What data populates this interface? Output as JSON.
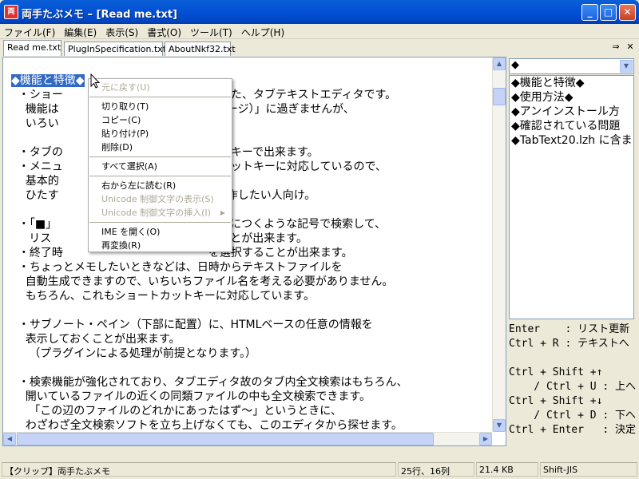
{
  "window": {
    "title": "両手たぶメモ – [Read me.txt]",
    "icon_glyph": "両",
    "buttons": {
      "minimize": "_",
      "maximize": "□",
      "close": "✕"
    }
  },
  "menu": [
    "ファイル(F)",
    "編集(E)",
    "表示(S)",
    "書式(O)",
    "ツール(T)",
    "ヘルプ(H)"
  ],
  "tabs": [
    {
      "label": "Read me.txt",
      "active": true
    },
    {
      "label": "PlugInSpecification.txt",
      "active": false
    },
    {
      "label": "AboutNkf32.txt",
      "active": false
    }
  ],
  "tab_controls": {
    "arrow": "⇒",
    "close": "✕"
  },
  "editor": {
    "lines": [
      {
        "selected": "◆機能と特徴◆",
        "text": ""
      },
      {
        "text": "  ・ショー　　　　　　　　　　　　　現した、タブテキストエディタです。"
      },
      {
        "text": "    機能は　　　　　　　　　　　　　２ページ）」に過ぎませんが、"
      },
      {
        "text": "    いろい　　　　　　　　　　　　　ます。"
      },
      {
        "text": ""
      },
      {
        "text": "  ・タブの　　　　　　　　　　　　　ットキーで出来ます。"
      },
      {
        "text": "  ・メニュ　　　　　　　　　　　　　トカットキーに対応しているので、"
      },
      {
        "text": "    基本的　　　　　　　　　　　　　ん。"
      },
      {
        "text": "    ひたす　　　　　　　　　　　　　を操作したい人向け。"
      },
      {
        "text": ""
      },
      {
        "text": "  ・「■」　　　　　　　　　　　　　トの頭につくような記号で検索して、"
      },
      {
        "text": "     リス　　　　　　　　　　　　　おくことが出来ます。"
      },
      {
        "text": "  ・終了時　　　　　　　　　　　　　を選択することが出来ます。"
      },
      {
        "text": "  ・ちょっとメモしたいときなどは、日時からテキストファイルを"
      },
      {
        "text": "    自動生成できますので、いちいちファイル名を考える必要がありません。"
      },
      {
        "text": "    もちろん、これもショートカットキーに対応しています。"
      },
      {
        "text": ""
      },
      {
        "text": "  ・サブノート・ペイン（下部に配置）に、HTMLベースの任意の情報を"
      },
      {
        "text": "    表示しておくことが出来ます。"
      },
      {
        "text": "     （プラグインによる処理が前提となります。）"
      },
      {
        "text": ""
      },
      {
        "text": "  ・検索機能が強化されており、タブエディタ故のタブ内全文検索はもちろん、"
      },
      {
        "text": "    開いているファイルの近くの同類ファイルの中も全文検索できます。"
      },
      {
        "text": "     「この辺のファイルのどれかにあったはず〜」というときに、"
      },
      {
        "text": "    わざわざ全文検索ソフトを立ち上げなくても、このエディタから探せます。"
      }
    ]
  },
  "context_menu": [
    {
      "label": "元に戻す(U)",
      "disabled": true
    },
    {
      "sep": true
    },
    {
      "label": "切り取り(T)",
      "disabled": false
    },
    {
      "label": "コピー(C)",
      "disabled": false
    },
    {
      "label": "貼り付け(P)",
      "disabled": false
    },
    {
      "label": "削除(D)",
      "disabled": false
    },
    {
      "sep": true
    },
    {
      "label": "すべて選択(A)",
      "disabled": false
    },
    {
      "sep": true
    },
    {
      "label": "右から左に読む(R)",
      "disabled": false
    },
    {
      "label": "Unicode 制御文字の表示(S)",
      "disabled": true
    },
    {
      "label": "Unicode 制御文字の挿入(I)",
      "disabled": true,
      "submenu": true
    },
    {
      "sep": true
    },
    {
      "label": "IME を開く(O)",
      "disabled": false
    },
    {
      "label": "再変換(R)",
      "disabled": false
    }
  ],
  "outline": {
    "selected": "◆",
    "items": [
      "◆機能と特徴◆",
      "◆使用方法◆",
      "◆アンインストール方",
      "◆確認されている問題",
      "◆TabText20.lzh に含ま"
    ]
  },
  "subnote": {
    "lines": [
      "Enter    : リスト更新",
      "Ctrl + R : テキストへ",
      "",
      "Ctrl + Shift +↑",
      "    / Ctrl + U : 上へ",
      "Ctrl + Shift +↓",
      "    / Ctrl + D : 下へ",
      "Ctrl + Enter   : 決定"
    ]
  },
  "status": {
    "clip": "【クリップ】両手たぶメモ",
    "position": "25行、16列",
    "size": "21.4 KB",
    "encoding": "Shift-JIS"
  },
  "colors": {
    "title_bar": "#0453d6",
    "selection": "#316ac5",
    "face": "#ece9d8"
  }
}
